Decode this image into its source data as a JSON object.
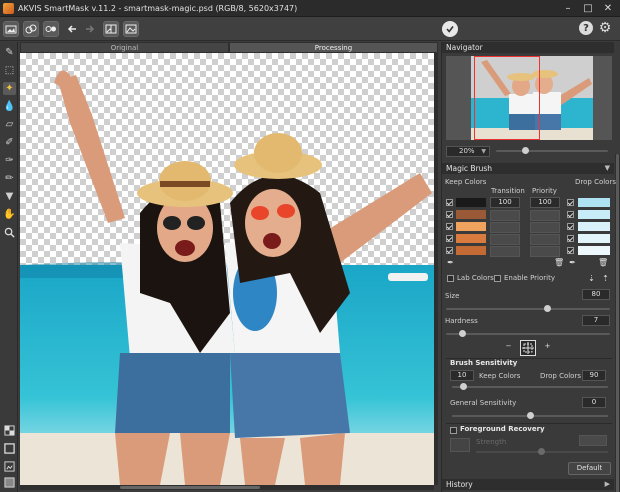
{
  "window": {
    "title": "AKVIS SmartMask v.11.2 - smartmask-magic.psd (RGB/8, 5620x3747)"
  },
  "view_tabs": [
    {
      "label": "Original"
    },
    {
      "label": "Processing"
    }
  ],
  "navigator": {
    "title": "Navigator",
    "zoom": "20%"
  },
  "magic_brush": {
    "title": "Magic Brush",
    "keep_colors_label": "Keep Colors",
    "transition_label": "Transition",
    "priority_label": "Priority",
    "drop_colors_label": "Drop Colors",
    "transition_value": "100",
    "priority_value": "100",
    "keep_colors": [
      "#1a1a1a",
      "#9a5a37",
      "#f0a35f",
      "#d97a3e",
      "#c46a34"
    ],
    "drop_colors": [
      "#aee1f2",
      "#c8ecf7",
      "#d9f2fa",
      "#e2f5fb",
      "#ecf8fc"
    ],
    "lab_colors_label": "Lab Colors",
    "enable_priority_label": "Enable Priority",
    "size_label": "Size",
    "size_value": "80",
    "hardness_label": "Hardness",
    "hardness_value": "7",
    "size_fraction": 0.62,
    "hardness_fraction": 0.1
  },
  "brush_sensitivity": {
    "title": "Brush Sensitivity",
    "keep_value": "10",
    "keep_label": "Keep Colors",
    "drop_label": "Drop Colors",
    "drop_value": "90",
    "general_label": "General Sensitivity",
    "general_value": "0",
    "general_fraction": 0.5
  },
  "foreground_recovery": {
    "title": "Foreground Recovery",
    "strength_label": "Strength"
  },
  "buttons": {
    "default": "Default",
    "minus": "−",
    "plus": "+"
  },
  "history": {
    "title": "History"
  }
}
